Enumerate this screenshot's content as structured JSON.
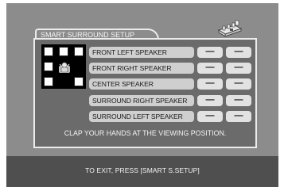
{
  "setup": {
    "title": "SMART SURROUND SETUP",
    "speakers": [
      {
        "label": "FRONT LEFT SPEAKER",
        "value_a": "—",
        "value_b": "—"
      },
      {
        "label": "FRONT RIGHT SPEAKER",
        "value_a": "—",
        "value_b": "—"
      },
      {
        "label": "CENTER SPEAKER",
        "value_a": "—",
        "value_b": "—"
      },
      {
        "label": "SURROUND RIGHT SPEAKER",
        "value_a": "—",
        "value_b": "—"
      },
      {
        "label": "SURROUND LEFT SPEAKER",
        "value_a": "—",
        "value_b": "—"
      }
    ],
    "instruction": "CLAP YOUR HANDS AT THE VIEWING POSITION."
  },
  "footer": {
    "exit_text": "TO EXIT, PRESS [SMART S.SETUP]"
  },
  "icons": {
    "top_right": "speaker-setup-icon",
    "diagram_center": "listener-icon"
  },
  "colors": {
    "screen_bg": "#8c8c8c",
    "panel_bg": "#6b6b6b",
    "footer_bg": "#4f4f4f",
    "label_bg": "#cfcfcf"
  }
}
